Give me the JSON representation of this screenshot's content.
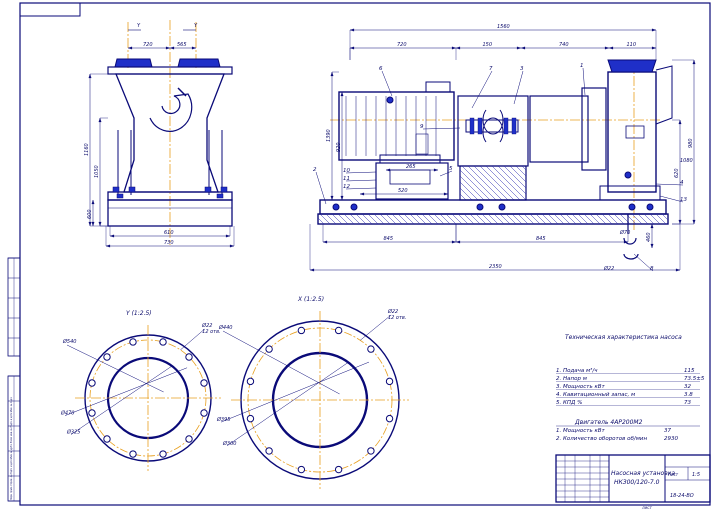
{
  "colors": {
    "line": "#0a0a78",
    "ink": "#0a0a6a",
    "axis": "#e8a020",
    "hatch": "#2a2ab0",
    "blue_fill": "#1f2fc8",
    "paper": "#ffffff"
  },
  "dimensions": {
    "side": {
      "y1": "Y",
      "y2": "Y",
      "d_720": "720",
      "d_565": "565",
      "h_1160": "1160",
      "h_1050": "1050",
      "h_600": "600",
      "w_610": "610",
      "w_730": "730"
    },
    "front": {
      "total": "1560",
      "d_720": "720",
      "d_150": "150",
      "d_740": "740",
      "d_110": "110",
      "h_920": "920",
      "h_1390": "1390",
      "h_620": "620",
      "h_1080": "1080",
      "h_980": "980",
      "d_215": "215",
      "d_265": "265",
      "d_520": "520",
      "d_845a": "845",
      "d_845b": "845",
      "d_2350": "2350",
      "d_670": "Ø70",
      "d_460": "460",
      "d_602": "Ø22"
    }
  },
  "callouts": [
    "1",
    "2",
    "3",
    "4",
    "5",
    "6",
    "7",
    "8",
    "9",
    "10",
    "11",
    "12",
    "13"
  ],
  "views": {
    "y_title": "Y (1:2.5)",
    "x_title": "X (1:2.5)",
    "y_dims": {
      "d_outer": "Ø540",
      "d_bolt": "Ø470",
      "d_inner": "Ø325",
      "d_hole": "Ø22",
      "holes": "12 отв."
    },
    "x_dims": {
      "d_outer": "Ø440",
      "d_bolt": "Ø395",
      "d_inner": "Ø300",
      "d_hole": "Ø22",
      "holes": "12 отв."
    }
  },
  "specs": {
    "title": "Техническая характеристика насоса",
    "rows": [
      {
        "label": "1. Подача м³/ч",
        "value": "115"
      },
      {
        "label": "2. Напор м",
        "value": "73.5±5"
      },
      {
        "label": "3. Мощность кВт",
        "value": "32"
      },
      {
        "label": "4. Кавитационный запас, м",
        "value": "3.8"
      },
      {
        "label": "5. КПД %",
        "value": "73"
      }
    ],
    "engine_title": "Двигатель 4АР200М2",
    "engine_rows": [
      {
        "label": "1. Мощность кВт",
        "value": "37"
      },
      {
        "label": "2. Количество оборотов об/мин",
        "value": "2930"
      }
    ]
  },
  "title_block": {
    "name_line1": "Насосная установка",
    "name_line2": "НКЗ00/120-7.0",
    "scale_label": "1:5",
    "sheet_label": "Лист",
    "code": "18-24-ВО"
  },
  "sheet_marks": {
    "left_strip": "Перв. прим.  Справ. №  Подп. и дата  Инв. № дубл.  Взам. инв. №  Подп. и дата  Инв. № подл.",
    "stamp": "ЛИСТ"
  }
}
